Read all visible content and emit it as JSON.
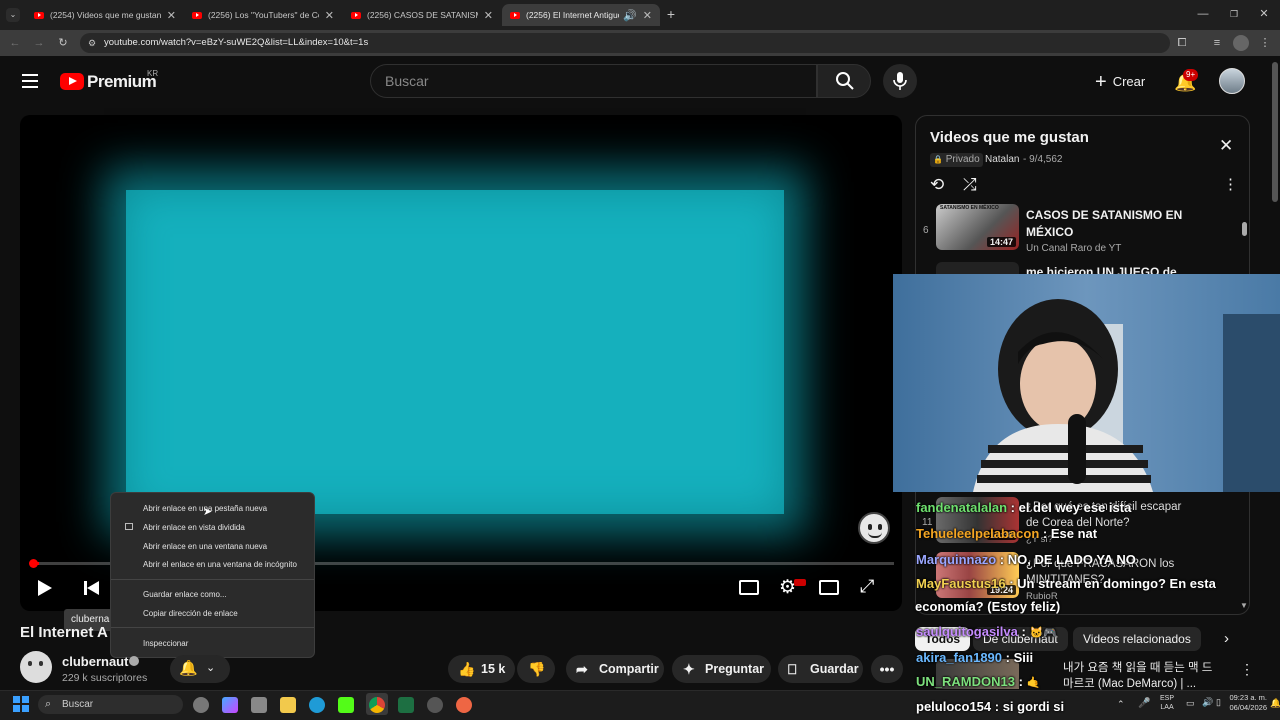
{
  "browser": {
    "tabs": [
      {
        "title": "(2254) Videos que me gustan -"
      },
      {
        "title": "(2256) Los \"YouTubers\" de Core"
      },
      {
        "title": "(2256) CASOS DE SATANISMO E"
      },
      {
        "title": "(2256) El Internet Antiguo d"
      }
    ],
    "url": "youtube.com/watch?v=eBzY-suWE2Q&list=LL&index=10&t=1s"
  },
  "youtube": {
    "logo_text": "Premium",
    "region": "KR",
    "search_placeholder": "Buscar",
    "create_label": "Crear",
    "notif_count": "9+"
  },
  "player": {
    "tooltip": "clubernaut",
    "progress": 0.01
  },
  "context_menu": {
    "items": [
      "Abrir enlace en una pestaña nueva",
      "Abrir enlace en vista dividida",
      "Abrir enlace en una ventana nueva",
      "Abrir el enlace en una ventana de incógnito",
      "Guardar enlace como...",
      "Copiar dirección de enlace",
      "Inspeccionar"
    ]
  },
  "video": {
    "title_partial": "El Internet A",
    "channel": "clubernaut",
    "subscribers": "229 k suscriptores",
    "likes": "15 k",
    "share": "Compartir",
    "ask": "Preguntar",
    "save": "Guardar"
  },
  "playlist": {
    "title": "Videos que me gustan",
    "privacy": "Privado",
    "owner": "Natalan",
    "position": "- 9/4,562",
    "items": [
      {
        "index": "6",
        "title_line1": "CASOS DE SATANISMO EN",
        "title_line2": "MÉXICO",
        "channel": "Un Canal Raro de YT",
        "duration": "14:47",
        "thumb_text": "SATANISMO EN MÉXICO"
      },
      {
        "title_line1": "me hicieron UN JUEGO de"
      },
      {
        "index": "11",
        "title_line1": "¿Por qué es tan difícil escapar",
        "title_line2": "de Corea del Norte?",
        "channel": "¿Y si?",
        "duration": "17:38"
      },
      {
        "title_line1": "¿Por qué FRACASARON los",
        "title_line2": "MINITITANES?",
        "channel": "RubioR",
        "duration": "19:24"
      }
    ]
  },
  "chips": {
    "all": "Todos",
    "channel": "De clubernaut",
    "related": "Videos relacionados"
  },
  "related_video": {
    "title_line1": "내가 요즘 책 읽을 때 듣는 맥 드",
    "title_line2": "마르코 (Mac DeMarco) | ..."
  },
  "chat": [
    {
      "user": "fandenatalalan",
      "msg": "el del wey ese ista",
      "color": "#6ee06e"
    },
    {
      "user": "Tehueleelpelabacon",
      "msg": "Ese nat",
      "color": "#f5a623"
    },
    {
      "user": "Marquinnazo",
      "msg": "NO, DE LADO YA NO",
      "color": "#9aa6ff"
    },
    {
      "user": "MayFaustus16",
      "msg": "Un stream en domingo? En esta",
      "color": "#f0d050"
    },
    {
      "user": "",
      "msg": "economía? (Estoy feliz)",
      "color": "#ffffff"
    },
    {
      "user": "saulquitogasilva",
      "msg": "",
      "color": "#c58bff"
    },
    {
      "user": "akira_fan1890",
      "msg": "Siii",
      "color": "#6ab8ff"
    },
    {
      "user": "UN_RAMDON13",
      "msg": "",
      "color": "#7de07d"
    },
    {
      "user": "peluloco154",
      "msg": "si gordi si",
      "color": "#ffffff"
    }
  ],
  "taskbar": {
    "search": "Buscar",
    "lang1": "ESP",
    "lang2": "LAA",
    "time": "09:23 a. m.",
    "date": "06/04/2026"
  }
}
